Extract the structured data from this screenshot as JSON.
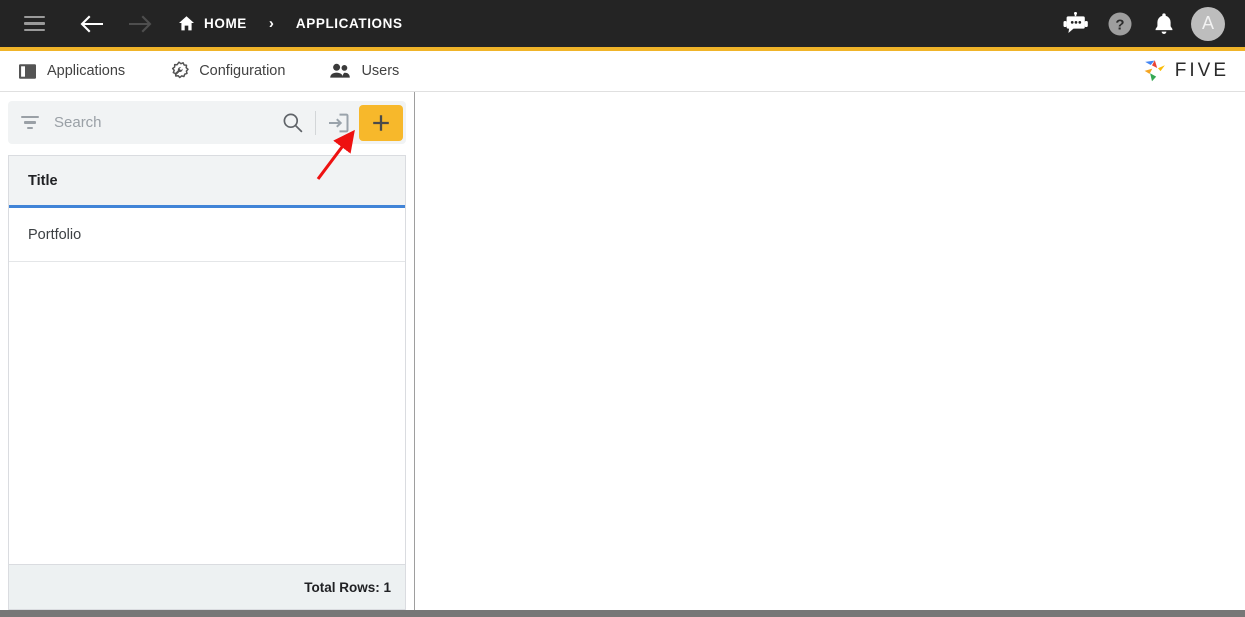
{
  "topbar": {
    "menu_icon": "hamburger-menu-icon",
    "back_icon": "arrow-back-icon",
    "forward_icon": "arrow-forward-icon",
    "breadcrumbs": [
      {
        "label": "HOME",
        "icon": "home-icon"
      },
      {
        "label": "APPLICATIONS",
        "icon": ""
      }
    ],
    "separator": "›",
    "actions": [
      {
        "name": "chatbot-icon",
        "label": ""
      },
      {
        "name": "help-icon",
        "label": "?"
      },
      {
        "name": "notifications-bell-icon",
        "label": ""
      }
    ],
    "avatar_initial": "A",
    "background": "#242424",
    "accent_underline": "#f0b429"
  },
  "tabs": [
    {
      "label": "Applications",
      "icon": "applications-panel-icon",
      "active": true
    },
    {
      "label": "Configuration",
      "icon": "gear-wrench-icon",
      "active": false
    },
    {
      "label": "Users",
      "icon": "users-icon",
      "active": false
    }
  ],
  "brand": {
    "name": "FIVE",
    "logo_icon": "five-pinwheel-logo-icon",
    "colors": [
      "#4285f4",
      "#ea4335",
      "#fbbc05",
      "#f5a623",
      "#34a853"
    ]
  },
  "toolbar": {
    "filter_icon": "filter-icon",
    "search_placeholder": "Search",
    "search_value": "",
    "search_icon": "search-icon",
    "import_icon": "import-icon",
    "add_icon": "plus-icon",
    "add_button_color": "#f7b82b"
  },
  "grid": {
    "columns": [
      "Title"
    ],
    "rows": [
      {
        "Title": "Portfolio"
      }
    ],
    "header_underline_color": "#4184d7",
    "footer_label": "Total Rows: 1"
  },
  "annotation": {
    "type": "arrow",
    "color": "#ee1111",
    "points_to": "import-icon"
  }
}
